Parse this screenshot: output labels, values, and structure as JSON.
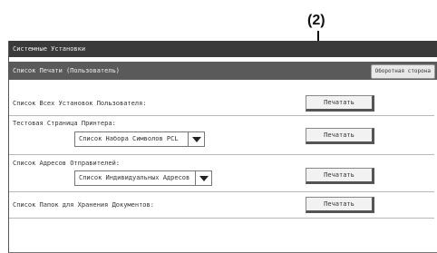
{
  "callout": {
    "label": "(2)"
  },
  "header": {
    "title": "Системные Установки"
  },
  "subheader": {
    "title": "Список Печати (Пользователь)",
    "reverse_button": "Оборотная сторона"
  },
  "rows": [
    {
      "label": "Список Всех Установок Пользователя:",
      "button": "Печатать"
    },
    {
      "label": "Тестовая Страница Принтера:",
      "select_value": "Список Набора Символов PCL",
      "button": "Печатать"
    },
    {
      "label": "Список Адресов Отправителей:",
      "select_value": "Список Индивидуальных Адресов",
      "button": "Печатать"
    },
    {
      "label": "Список Папок для Хранения Документов:",
      "button": "Печатать"
    }
  ],
  "icons": {
    "dropdown": "chevron-down-icon"
  }
}
